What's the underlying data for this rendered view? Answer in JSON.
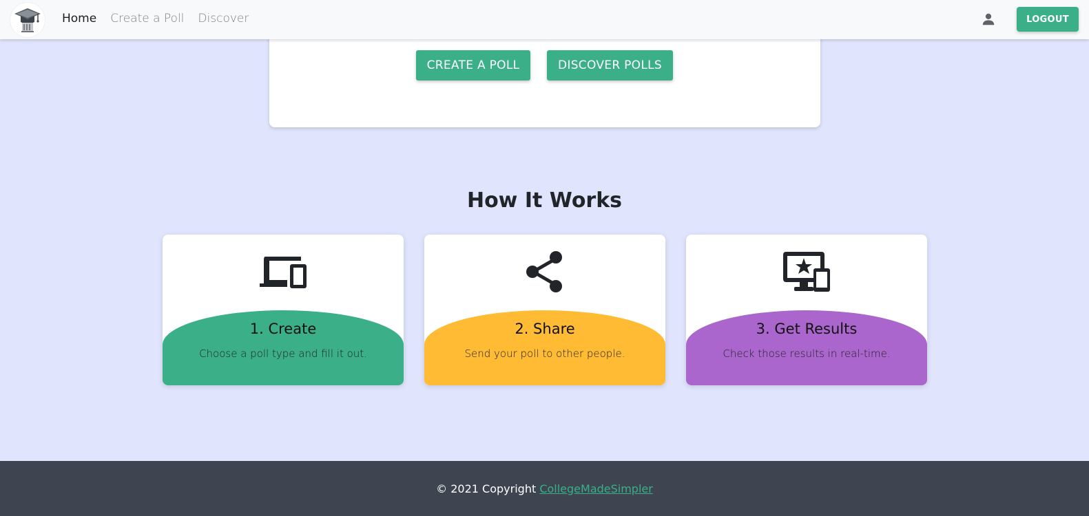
{
  "navbar": {
    "logo_alt": "graduation-cap-logo",
    "links": [
      {
        "label": "Home",
        "active": true
      },
      {
        "label": "Create a Poll",
        "active": false
      },
      {
        "label": "Discover",
        "active": false
      }
    ],
    "logout_label": "LOGOUT"
  },
  "hero": {
    "create_label": "CREATE A POLL",
    "discover_label": "DISCOVER POLLS"
  },
  "how_it_works": {
    "title": "How It Works",
    "steps": [
      {
        "title": "1. Create",
        "desc": "Choose a poll type and fill it out.",
        "icon": "devices-icon",
        "color": "#3aaf88"
      },
      {
        "title": "2. Share",
        "desc": "Send your poll to other people.",
        "icon": "share-icon",
        "color": "#ffbb33"
      },
      {
        "title": "3. Get Results",
        "desc": "Check those results in real-time.",
        "icon": "monitor-star-icon",
        "color": "#aa66cc"
      }
    ]
  },
  "footer": {
    "copyright": "© 2021 Copyright ",
    "link_label": "CollegeMadeSimpler"
  },
  "colors": {
    "primary": "#3aaf88",
    "warning": "#ffbb33",
    "purple": "#aa66cc",
    "background": "#e0e5fd",
    "footer": "#3e4551"
  }
}
